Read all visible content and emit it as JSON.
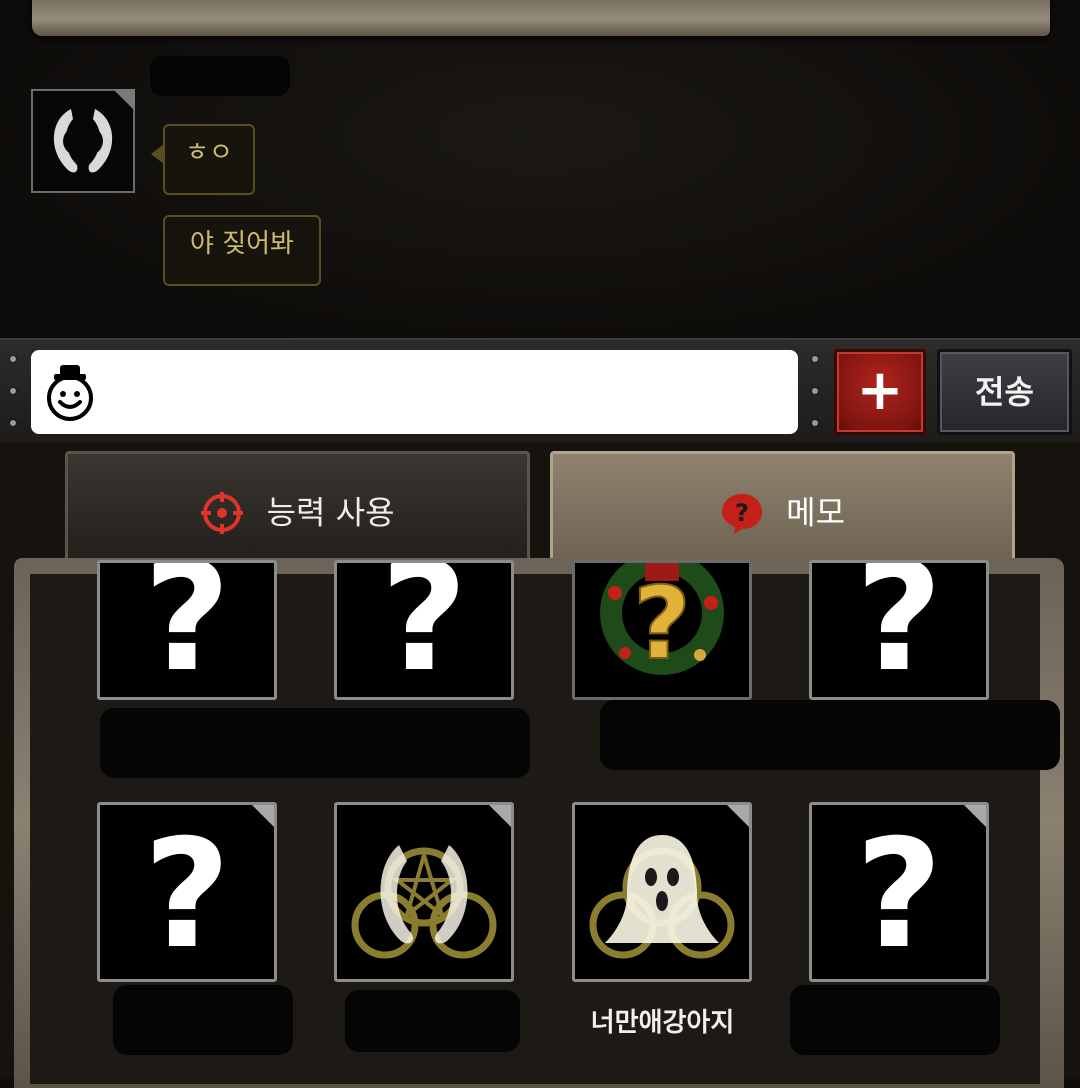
{
  "chat": {
    "messages": [
      {
        "text": "ㅎㅇ"
      },
      {
        "text": "야 짖어봐"
      }
    ]
  },
  "input_bar": {
    "message_value": "",
    "plus_label": "+",
    "send_label": "전송"
  },
  "tabs": [
    {
      "label": "능력 사용",
      "icon": "target-icon",
      "active": false
    },
    {
      "label": "메모",
      "icon": "question-bubble-icon",
      "active": true
    }
  ],
  "memo_cards": {
    "question_mark": "?",
    "row1": [
      {
        "icon": "question-mark"
      },
      {
        "icon": "question-mark"
      },
      {
        "icon": "christmas-wreath-question"
      },
      {
        "icon": "question-mark"
      }
    ],
    "row2": [
      {
        "icon": "question-mark",
        "name": ""
      },
      {
        "icon": "horns-sigil",
        "name": ""
      },
      {
        "icon": "ghost-sigil",
        "name": "너만애강아지"
      },
      {
        "icon": "question-mark",
        "name": ""
      }
    ]
  },
  "colors": {
    "bubble_border": "#5a4e1e",
    "bubble_text": "#cdbb6e",
    "plus_button": "#9b1e18",
    "active_tab": "#8f8370"
  }
}
